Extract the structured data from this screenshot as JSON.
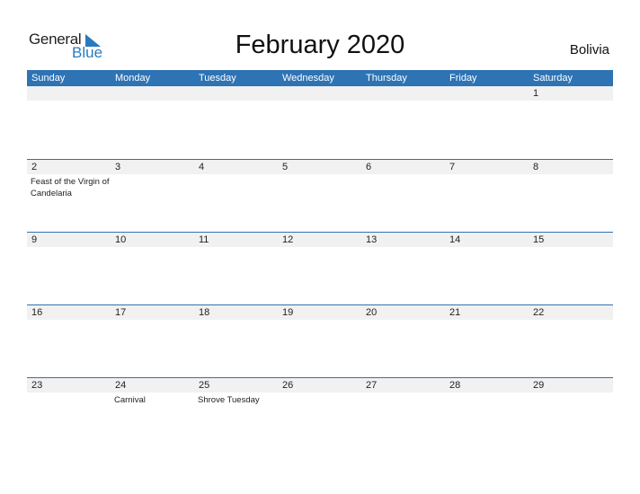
{
  "logo": {
    "line1": "General",
    "line2": "Blue"
  },
  "title": "February 2020",
  "country": "Bolivia",
  "weekdays": [
    "Sunday",
    "Monday",
    "Tuesday",
    "Wednesday",
    "Thursday",
    "Friday",
    "Saturday"
  ],
  "weeks": [
    [
      {
        "d": ""
      },
      {
        "d": ""
      },
      {
        "d": ""
      },
      {
        "d": ""
      },
      {
        "d": ""
      },
      {
        "d": ""
      },
      {
        "d": "1"
      }
    ],
    [
      {
        "d": "2",
        "e": "Feast of the Virgin of Candelaria"
      },
      {
        "d": "3"
      },
      {
        "d": "4"
      },
      {
        "d": "5"
      },
      {
        "d": "6"
      },
      {
        "d": "7"
      },
      {
        "d": "8"
      }
    ],
    [
      {
        "d": "9"
      },
      {
        "d": "10"
      },
      {
        "d": "11"
      },
      {
        "d": "12"
      },
      {
        "d": "13"
      },
      {
        "d": "14"
      },
      {
        "d": "15"
      }
    ],
    [
      {
        "d": "16"
      },
      {
        "d": "17"
      },
      {
        "d": "18"
      },
      {
        "d": "19"
      },
      {
        "d": "20"
      },
      {
        "d": "21"
      },
      {
        "d": "22"
      }
    ],
    [
      {
        "d": "23"
      },
      {
        "d": "24",
        "e": "Carnival"
      },
      {
        "d": "25",
        "e": "Shrove Tuesday"
      },
      {
        "d": "26"
      },
      {
        "d": "27"
      },
      {
        "d": "28"
      },
      {
        "d": "29"
      }
    ]
  ],
  "colors": {
    "accent": "#2e73b4",
    "strip": "#f1f1f1"
  }
}
